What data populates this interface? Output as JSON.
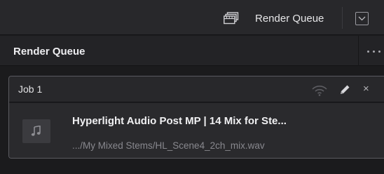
{
  "toolbar": {
    "render_queue_label": "Render Queue",
    "render_queue_icon": "render-queue-icon",
    "collapse_icon": "chevron-down-icon"
  },
  "panel": {
    "title": "Render Queue",
    "more_icon": "more-horizontal-icon"
  },
  "job": {
    "name": "Job 1",
    "title": "Hyperlight Audio Post MP | 14 Mix for Ste...",
    "path": ".../My Mixed Stems/HL_Scene4_2ch_mix.wav",
    "thumbnail_icon": "music-note-icon",
    "actions": [
      "remote-render-icon",
      "edit-icon",
      "close-icon"
    ],
    "close_glyph": "×"
  },
  "colors": {
    "background": "#1b1b1d",
    "toolbar": "#28282b",
    "card_border": "#5a5a60",
    "card_body": "#2a2a2d"
  }
}
